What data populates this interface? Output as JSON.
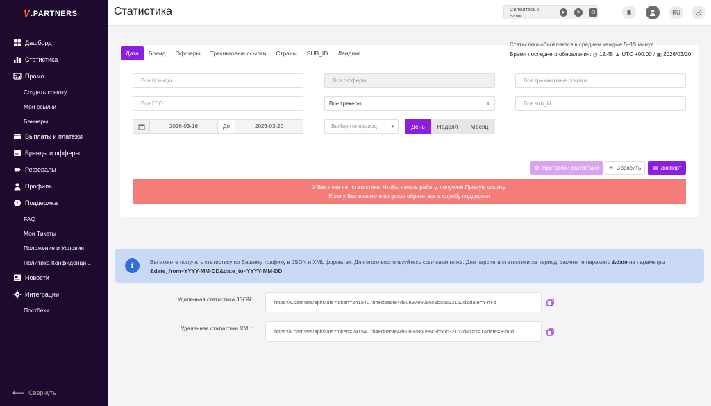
{
  "brand": {
    "logo_v": "V",
    "logo_text": ".PARTNERS"
  },
  "sidebar": {
    "items": [
      {
        "label": "Дашборд",
        "icon": "dashboard-icon"
      },
      {
        "label": "Статистика",
        "icon": "chart-icon"
      },
      {
        "label": "Промо",
        "icon": "promo-icon"
      },
      {
        "label": "Создать ссылку",
        "sub": true
      },
      {
        "label": "Мои ссылки",
        "sub": true
      },
      {
        "label": "Баннеры",
        "sub": true
      },
      {
        "label": "Выплаты и платежи",
        "icon": "payments-icon"
      },
      {
        "label": "Бренды и офферы",
        "icon": "brands-icon"
      },
      {
        "label": "Рефералы",
        "icon": "referrals-icon"
      },
      {
        "label": "Профиль",
        "icon": "profile-icon"
      },
      {
        "label": "Поддержка",
        "icon": "support-icon"
      },
      {
        "label": "FAQ",
        "sub": true
      },
      {
        "label": "Мои Тикеты",
        "sub": true
      },
      {
        "label": "Положения и Условия",
        "sub": true
      },
      {
        "label": "Политика Конфиденци...",
        "sub": true
      },
      {
        "label": "Новости",
        "icon": "news-icon"
      },
      {
        "label": "Интеграции",
        "icon": "integrations-icon"
      },
      {
        "label": "Постбеки",
        "sub": true
      }
    ],
    "collapse_label": "Свернуть"
  },
  "header": {
    "title": "Статистика",
    "contact_label": "Свяжитесь с нами:",
    "lang": "RU"
  },
  "update": {
    "line1": "Статистика обновляется в среднем каждые 5–15 минут.",
    "line2_label": "Время последнего обновления:",
    "time": "12:45",
    "tz": "UTC +00:00",
    "date": "2026/03/20"
  },
  "tabs": [
    "Дата",
    "Бренд",
    "Офферы",
    "Трекинговые ссылки",
    "Страны",
    "SUB_ID",
    "Лендинг"
  ],
  "filters": {
    "brands": "Все бренды",
    "offers": "Все офферы",
    "tracking": "Все трекинговые ссылки",
    "geo": "Все ГЕО",
    "trackers": "Все трекеры",
    "sub_id": "Все sub_id",
    "date_from": "2026-03-16",
    "date_to_label": "До",
    "date_to": "2026-03-20",
    "period_placeholder": "Выберите период",
    "period_day": "День",
    "period_week": "Неделя",
    "period_month": "Месяц"
  },
  "actions": {
    "settings": "Настройки статистики",
    "reset": "Сбросить",
    "export": "Экспорт"
  },
  "alert": {
    "line1": "У Вас пока нет статистики. Чтобы начать работу, получите Прямую ссылку.",
    "line2": "Если у Вас возникли вопросы обратитесь в службу поддержки"
  },
  "info": {
    "text": "Вы можете получать статистику по Вашему трафику в JSON и XML форматах. Для этого воспользуйтесь ссылками ниже. Для парсинга статистики за период, замените параметр ",
    "param": "&date",
    "text2": " на параметры ",
    "params2": "&date_from=YYYY-MM-DD&date_to=YYYY-MM-DD"
  },
  "api": {
    "json_label": "Удаленная статистика JSON:",
    "json_url": "https://v.partners/api/stats?token=2415407b4ed8a5fe4d8089786095c9b55c32162d&date=Y-m-d",
    "xml_label": "Удаленная статистика XML:",
    "xml_url": "https://v.partners/api/stats?token=2415407b4ed8a5fe4d8089786095c9b55c32162d&xml=1&date=Y-m-d"
  },
  "colors": {
    "accent": "#8a1fe0",
    "sidebar": "#1e0a2e",
    "alert": "#f47c79",
    "info": "#c8d8f5"
  }
}
